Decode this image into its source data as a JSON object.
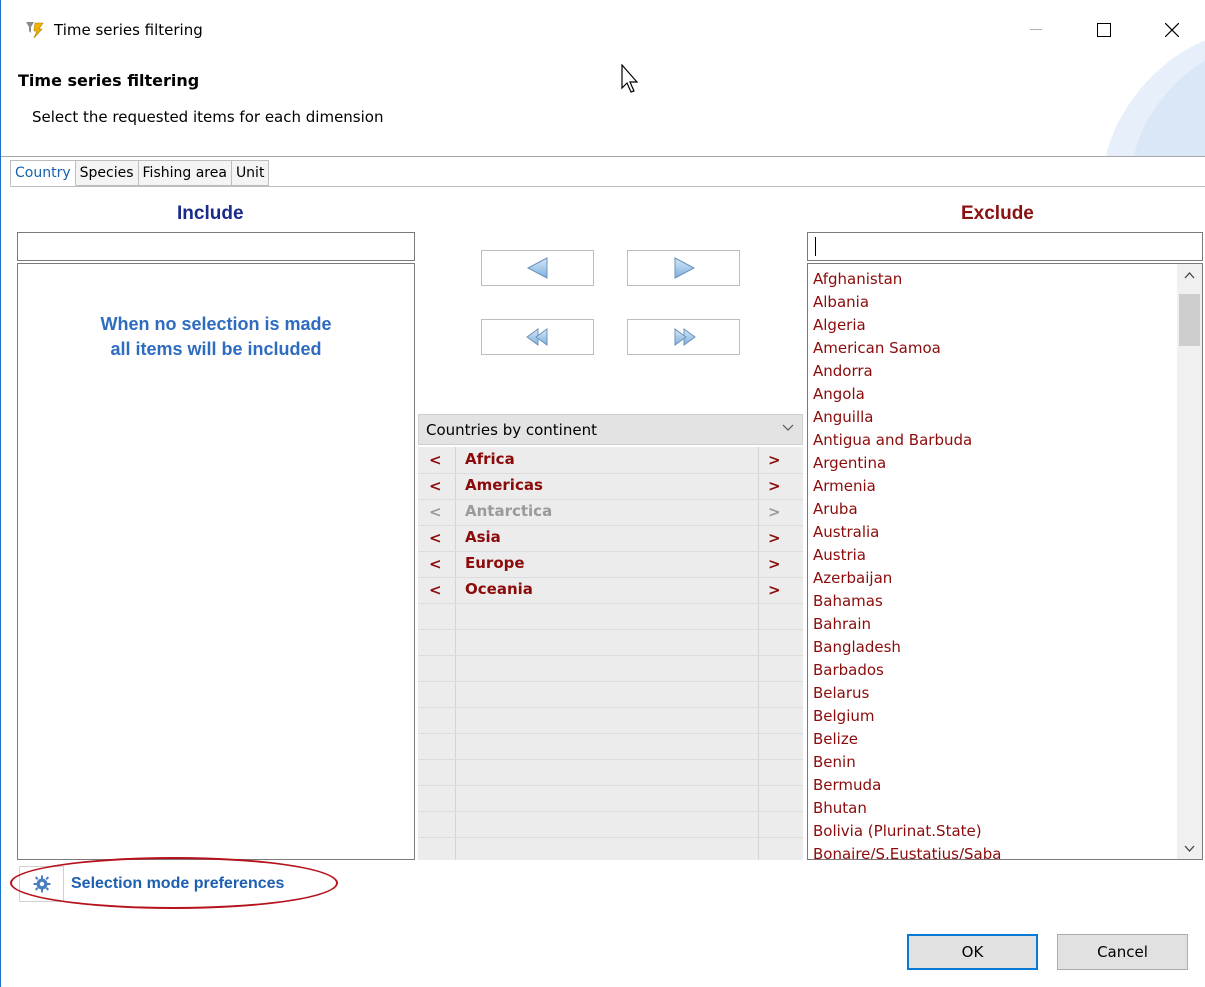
{
  "window": {
    "title": "Time series filtering",
    "controls": {
      "minimize_icon": "minimize-icon",
      "maximize_icon": "maximize-icon",
      "close_icon": "close-icon"
    }
  },
  "header": {
    "title": "Time series filtering",
    "subtitle": "Select the requested items for each dimension"
  },
  "tabs": [
    {
      "label": "Country",
      "active": true
    },
    {
      "label": "Species",
      "active": false
    },
    {
      "label": "Fishing area",
      "active": false
    },
    {
      "label": "Unit",
      "active": false
    }
  ],
  "include": {
    "heading": "Include",
    "filter_value": "",
    "empty_message": "When no selection is made all items will be included"
  },
  "exclude": {
    "heading": "Exclude",
    "filter_value": "",
    "items": [
      "Afghanistan",
      "Albania",
      "Algeria",
      "American Samoa",
      "Andorra",
      "Angola",
      "Anguilla",
      "Antigua and Barbuda",
      "Argentina",
      "Armenia",
      "Aruba",
      "Australia",
      "Austria",
      "Azerbaijan",
      "Bahamas",
      "Bahrain",
      "Bangladesh",
      "Barbados",
      "Belarus",
      "Belgium",
      "Belize",
      "Benin",
      "Bermuda",
      "Bhutan",
      "Bolivia (Plurinat.State)",
      "Bonaire/S.Eustatius/Saba"
    ]
  },
  "continents": {
    "selector_value": "Countries by continent",
    "move_left": "<",
    "move_right": ">",
    "rows": [
      {
        "name": "Africa",
        "enabled": true
      },
      {
        "name": "Americas",
        "enabled": true
      },
      {
        "name": "Antarctica",
        "enabled": false
      },
      {
        "name": "Asia",
        "enabled": true
      },
      {
        "name": "Europe",
        "enabled": true
      },
      {
        "name": "Oceania",
        "enabled": true
      }
    ]
  },
  "preferences": {
    "label": "Selection mode preferences"
  },
  "buttons": {
    "ok": "OK",
    "cancel": "Cancel"
  },
  "colors": {
    "include_heading": "#1c2a8a",
    "exclude_heading": "#8b1010",
    "country_text": "#8b0b0b",
    "empty_message": "#2e6cc0",
    "ok_border": "#0a78d7",
    "annotation_ellipse": "#b5121b"
  }
}
